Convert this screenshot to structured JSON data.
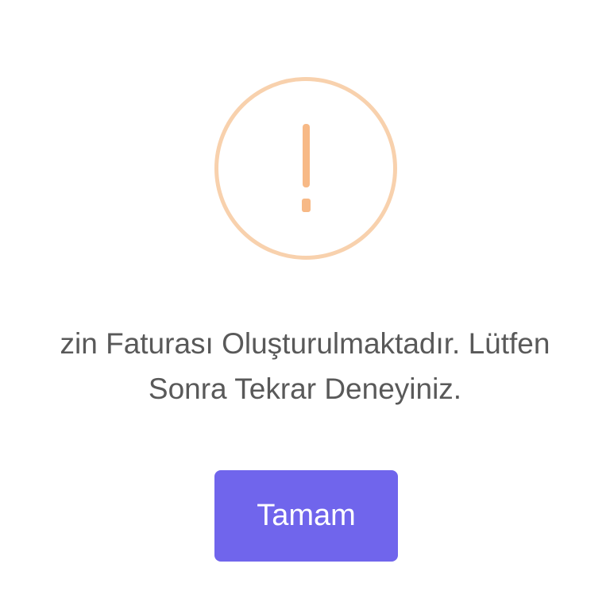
{
  "dialog": {
    "icon": "warning-exclamation-icon",
    "message_line_1": "zin Faturası Oluşturulmaktadır. Lütfen",
    "message_line_2": "Sonra Tekrar Deneyiniz.",
    "confirm_label": "Tamam"
  },
  "colors": {
    "icon_ring": "#f8d1ad",
    "icon_mark": "#f7b986",
    "text": "#595959",
    "button_bg": "#7065ec",
    "button_text": "#ffffff"
  }
}
